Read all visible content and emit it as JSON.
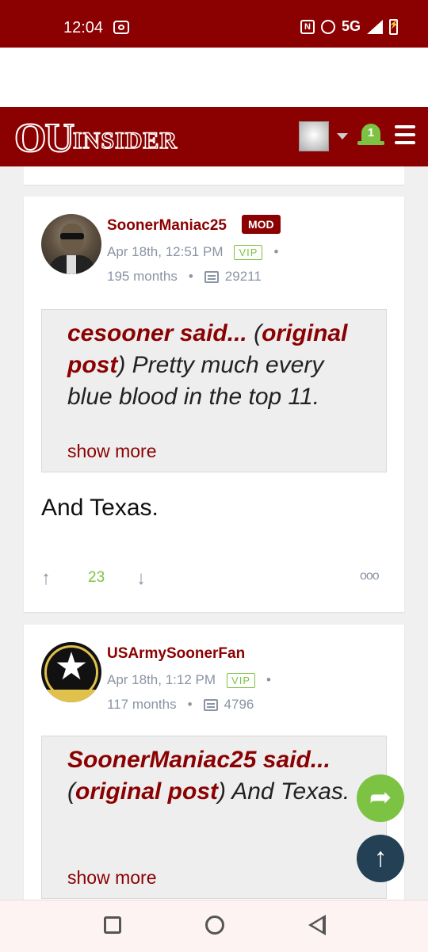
{
  "status_bar": {
    "time": "12:04",
    "network": "5G"
  },
  "header": {
    "logo_ou": "OU",
    "logo_insider": "INSIDER",
    "notifications_count": "1"
  },
  "posts": [
    {
      "username": "SoonerManiac25",
      "role_badge": "MOD",
      "date": "Apr 18th, 12:51 PM",
      "badge": "VIP",
      "tenure": "195 months",
      "post_count": "29211",
      "quote_author": "cesooner said...",
      "quote_link_open": "(",
      "quote_link": "original post",
      "quote_link_close": ")",
      "quote_body": "Pretty much every blue blood in the top 11.",
      "show_more": "show more",
      "body": "And Texas.",
      "votes": "23"
    },
    {
      "username": "USArmySoonerFan",
      "date": "Apr 18th, 1:12 PM",
      "badge": "VIP",
      "tenure": "117 months",
      "post_count": "4796",
      "quote_author": "SoonerManiac25 said...",
      "quote_link_open": "(",
      "quote_link": "original post",
      "quote_link_close": ")",
      "quote_body": "And Texas.",
      "show_more": "show more"
    }
  ],
  "colors": {
    "brand": "#8b0000",
    "accent_green": "#7cc243",
    "fab_dark": "#244055"
  }
}
